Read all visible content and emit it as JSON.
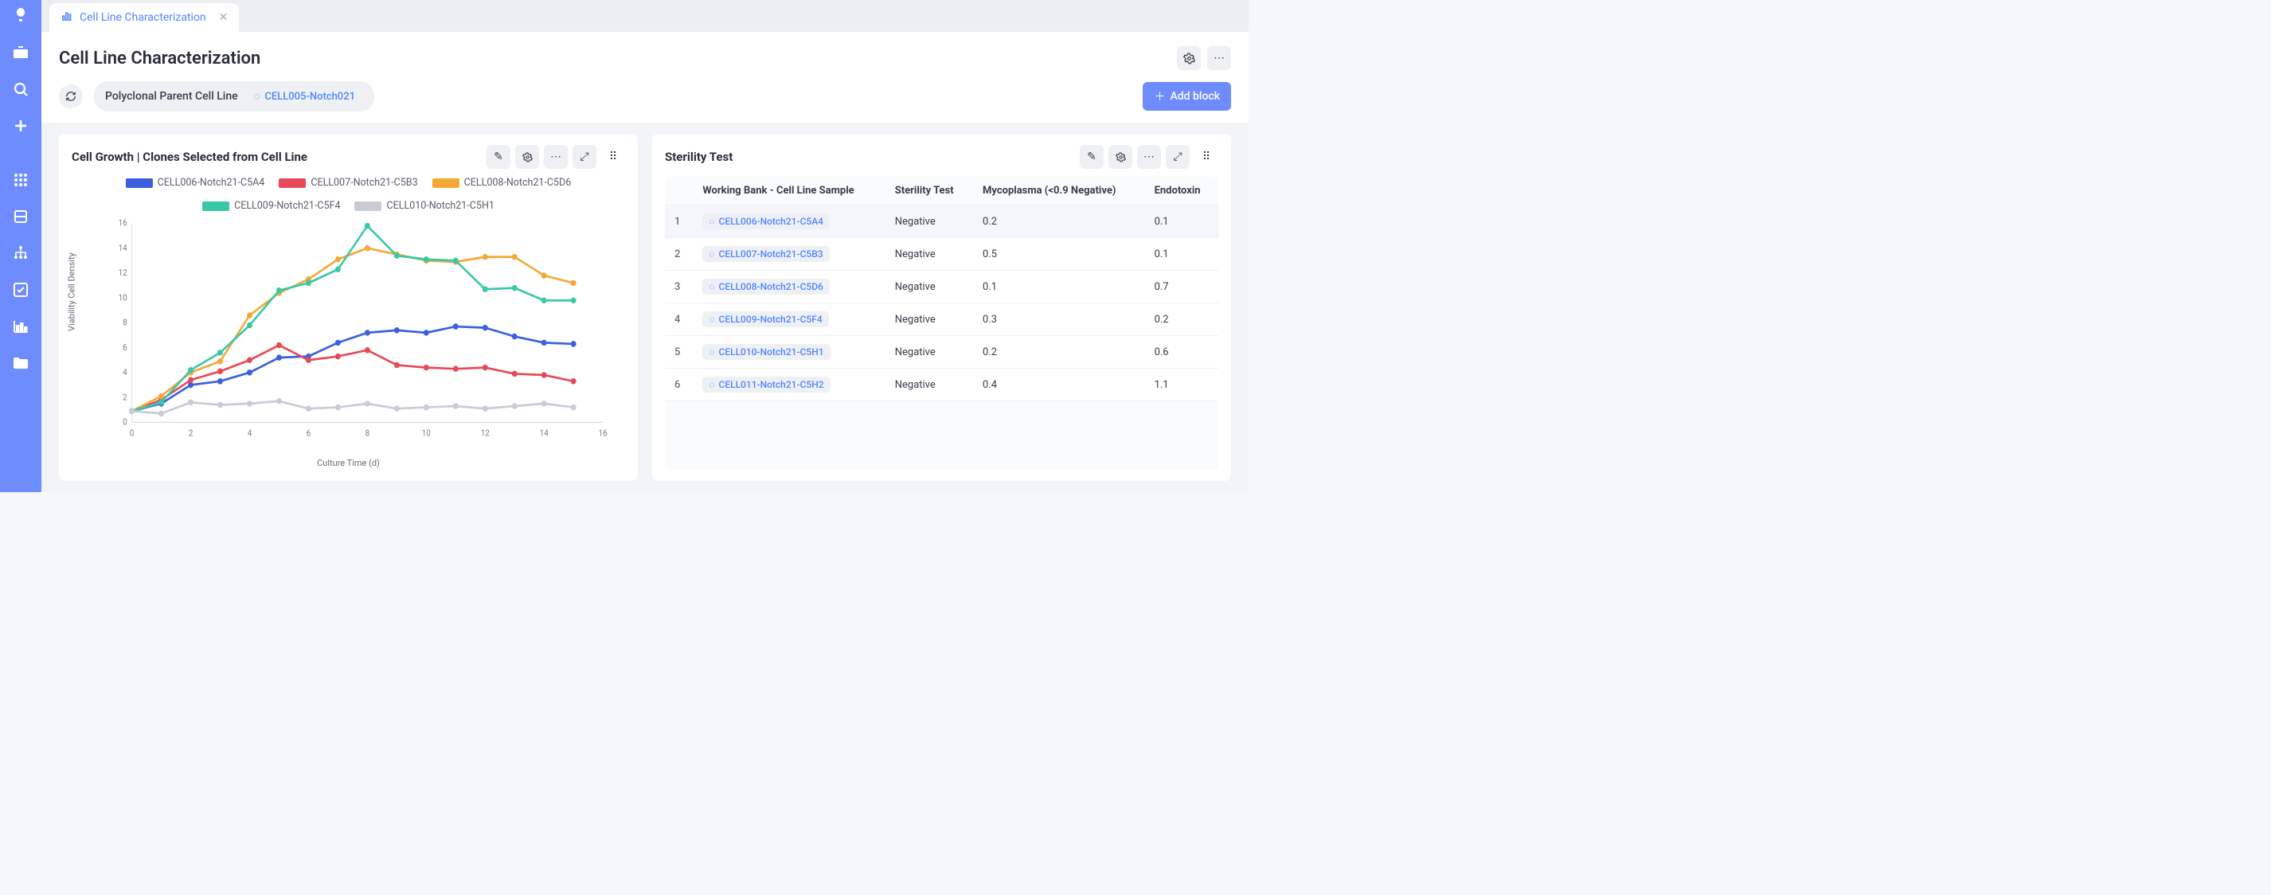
{
  "tab": {
    "label": "Cell Line Characterization"
  },
  "header": {
    "title": "Cell Line Characterization"
  },
  "breadcrumb": {
    "polyclonal_label": "Polyclonal Parent Cell Line",
    "cell_ref": "CELL005-Notch021",
    "add_block": "Add block"
  },
  "growth_panel": {
    "title": "Cell Growth | Clones Selected from Cell Line"
  },
  "sterility_panel": {
    "title": "Sterility Test"
  },
  "chart_data": {
    "type": "line",
    "title": "Cell Growth | Clones Selected from Cell Line",
    "xlabel": "Culture Time (d)",
    "ylabel": "Viability Cell Density",
    "xlim": [
      0,
      16
    ],
    "ylim": [
      0,
      16
    ],
    "x_ticks": [
      0,
      2,
      4,
      6,
      8,
      10,
      12,
      14,
      16
    ],
    "y_ticks": [
      0,
      2,
      4,
      6,
      8,
      10,
      12,
      14,
      16
    ],
    "x": [
      0,
      1,
      2,
      3,
      4,
      5,
      6,
      7,
      8,
      9,
      10,
      11,
      12,
      13,
      14,
      15
    ],
    "series": [
      {
        "name": "CELL006-Notch21-C5A4",
        "color": "#3b5fe0",
        "values": [
          0.9,
          1.5,
          3.0,
          3.3,
          4.0,
          5.2,
          5.3,
          6.4,
          7.2,
          7.4,
          7.2,
          7.7,
          7.6,
          6.9,
          6.4,
          6.3
        ]
      },
      {
        "name": "CELL007-Notch21-C5B3",
        "color": "#e64a58",
        "values": [
          0.9,
          1.8,
          3.4,
          4.1,
          5.0,
          6.2,
          5.0,
          5.3,
          5.8,
          4.6,
          4.4,
          4.3,
          4.4,
          3.9,
          3.8,
          3.3
        ]
      },
      {
        "name": "CELL008-Notch21-C5D6",
        "color": "#f4a836",
        "values": [
          0.9,
          2.1,
          4.0,
          4.9,
          8.6,
          10.4,
          11.5,
          13.1,
          14.0,
          13.5,
          13.0,
          12.9,
          13.3,
          13.3,
          11.8,
          11.2
        ]
      },
      {
        "name": "CELL009-Notch21-C5F4",
        "color": "#3ac7a8",
        "values": [
          0.9,
          1.6,
          4.2,
          5.6,
          7.8,
          10.6,
          11.2,
          12.3,
          15.8,
          13.4,
          13.1,
          13.0,
          10.7,
          10.8,
          9.8,
          9.8
        ]
      },
      {
        "name": "CELL010-Notch21-C5H1",
        "color": "#c9ccd6",
        "values": [
          0.9,
          0.7,
          1.6,
          1.4,
          1.5,
          1.7,
          1.1,
          1.2,
          1.5,
          1.1,
          1.2,
          1.3,
          1.1,
          1.3,
          1.5,
          1.2
        ]
      }
    ]
  },
  "sterility_table": {
    "headers": {
      "sample": "Working Bank - Cell Line Sample",
      "sterility": "Sterility Test",
      "mycoplasma": "Mycoplasma (<0.9 Negative)",
      "endotoxin": "Endotoxin"
    },
    "rows": [
      {
        "n": "1",
        "sample": "CELL006-Notch21-C5A4",
        "sterility": "Negative",
        "mycoplasma": "0.2",
        "endotoxin": "0.1"
      },
      {
        "n": "2",
        "sample": "CELL007-Notch21-C5B3",
        "sterility": "Negative",
        "mycoplasma": "0.5",
        "endotoxin": "0.1"
      },
      {
        "n": "3",
        "sample": "CELL008-Notch21-C5D6",
        "sterility": "Negative",
        "mycoplasma": "0.1",
        "endotoxin": "0.7"
      },
      {
        "n": "4",
        "sample": "CELL009-Notch21-C5F4",
        "sterility": "Negative",
        "mycoplasma": "0.3",
        "endotoxin": "0.2"
      },
      {
        "n": "5",
        "sample": "CELL010-Notch21-C5H1",
        "sterility": "Negative",
        "mycoplasma": "0.2",
        "endotoxin": "0.6"
      },
      {
        "n": "6",
        "sample": "CELL011-Notch21-C5H2",
        "sterility": "Negative",
        "mycoplasma": "0.4",
        "endotoxin": "1.1"
      }
    ]
  }
}
